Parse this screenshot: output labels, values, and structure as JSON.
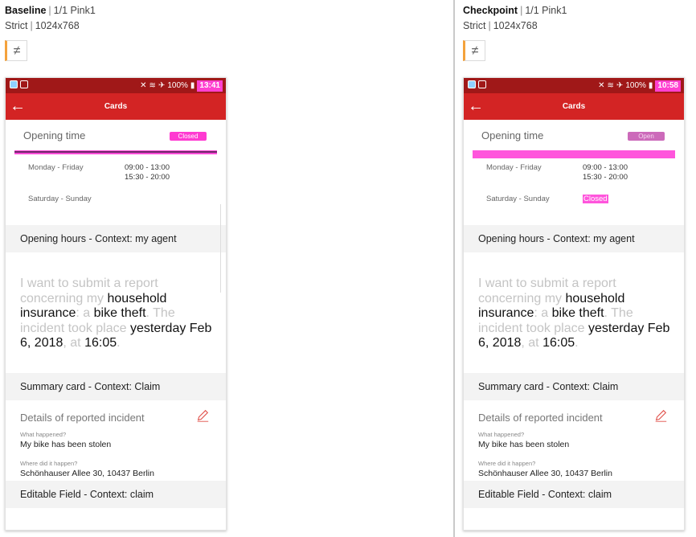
{
  "columns": {
    "baseline": {
      "header_name": "Baseline",
      "header_page": "1/1 Pink1",
      "header_mode": "Strict",
      "header_res": "1024x768",
      "neq_symbol": "≠",
      "status_time": "13:41",
      "status_battery": "100%",
      "app_title": "Cards",
      "opening_time_label": "Opening time",
      "opening_badge": "Closed",
      "weekday_label": "Monday - Friday",
      "weekday_hours_1": "09:00 - 13:00",
      "weekday_hours_2": "15:30 - 20:00",
      "weekend_label": "Saturday - Sunday",
      "weekend_hours": "",
      "section1": "Opening hours - Context: my agent",
      "story": [
        "I want to submit a report concerning my ",
        "household insurance",
        ": a ",
        "bike theft",
        ". The incident took place ",
        "yesterday Feb 6, 2018",
        ", at ",
        "16:05",
        "."
      ],
      "section2": "Summary card - Context: Claim",
      "details_title": "Details of reported incident",
      "q1": "What happened?",
      "a1": "My bike has been stolen",
      "q2": "Where did it happen?",
      "a2": "Schönhauser Allee 30, 10437 Berlin",
      "section3": "Editable Field - Context: claim"
    },
    "checkpoint": {
      "header_name": "Checkpoint",
      "header_page": "1/1 Pink1",
      "header_mode": "Strict",
      "header_res": "1024x768",
      "neq_symbol": "≠",
      "status_time": "10:58",
      "status_battery": "100%",
      "app_title": "Cards",
      "opening_time_label": "Opening time",
      "opening_badge": "Open",
      "weekday_label": "Monday - Friday",
      "weekday_hours_1": "09:00 - 13:00",
      "weekday_hours_2": "15:30 - 20:00",
      "weekend_label": "Saturday - Sunday",
      "weekend_hours": "Closed",
      "section1": "Opening hours - Context: my agent",
      "story": [
        "I want to submit a report concerning my ",
        "household insurance",
        ": a ",
        "bike theft",
        ". The incident took place ",
        "yesterday Feb 6, 2018",
        ", at ",
        "16:05",
        "."
      ],
      "section2": "Summary card - Context: Claim",
      "details_title": "Details of reported incident",
      "q1": "What happened?",
      "a1": "My bike has been stolen",
      "q2": "Where did it happen?",
      "a2": "Schönhauser Allee 30, 10437 Berlin",
      "section3": "Editable Field - Context: claim"
    }
  },
  "colors": {
    "statusbar": "#a01818",
    "appbar": "#d32424",
    "highlight_pink": "#ff3ad1",
    "header_accent": "#f4a23c"
  }
}
